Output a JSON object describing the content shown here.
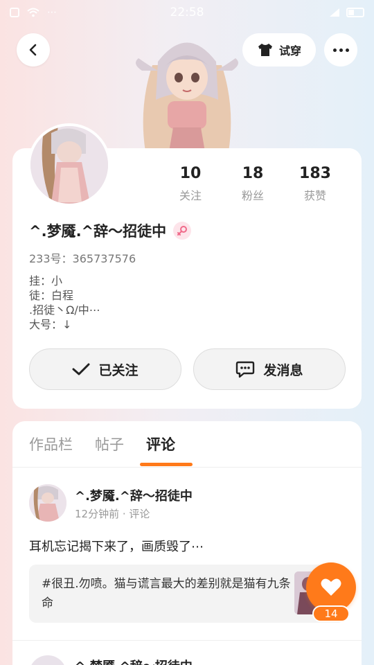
{
  "status_bar": {
    "time": "22:58",
    "left_icons": "⋯"
  },
  "header": {
    "tryon_label": "试穿"
  },
  "profile": {
    "nickname": "^.梦魇.^辞～招徒中",
    "uid": "233号：365737576",
    "bio_lines": [
      "挂：小",
      "徒：白程",
      ".招徒丶Ω/中⋯",
      "大号：↓"
    ],
    "stats": [
      {
        "value": "10",
        "label": "关注"
      },
      {
        "value": "18",
        "label": "粉丝"
      },
      {
        "value": "183",
        "label": "获赞"
      }
    ],
    "followed_label": "已关注",
    "message_label": "发消息"
  },
  "tabs": [
    {
      "label": "作品栏"
    },
    {
      "label": "帖子"
    },
    {
      "label": "评论"
    }
  ],
  "post": {
    "author": "^.梦魇.^辞～招徒中",
    "meta": "12分钟前 · 评论",
    "text": "耳机忘记揭下来了，画质毁了⋯",
    "quote": "#很丑.勿喷。猫与谎言最大的差别就是猫有九条命",
    "like_count": "14"
  },
  "post2": {
    "author": "^.梦魇.^辞～招徒中"
  },
  "colors": {
    "accent": "#ff7a1a"
  }
}
